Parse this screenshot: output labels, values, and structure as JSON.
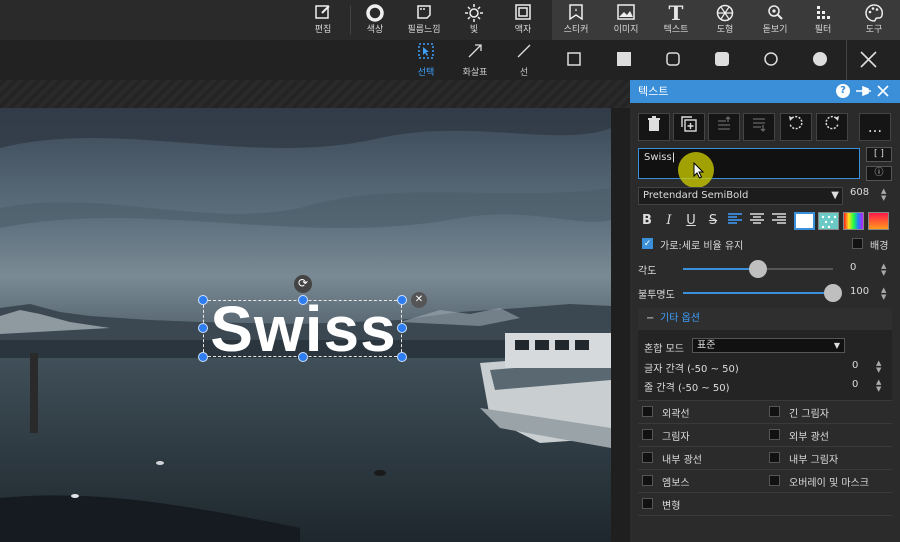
{
  "toolbar": {
    "tools": [
      {
        "label": "편집",
        "icon": "edit-icon"
      },
      {
        "label": "색상",
        "icon": "color-ring-icon"
      },
      {
        "label": "필름느낌",
        "icon": "film-icon"
      },
      {
        "label": "빛",
        "icon": "sun-icon"
      },
      {
        "label": "액자",
        "icon": "frame-icon"
      },
      {
        "label": "스티커",
        "icon": "sticker-icon"
      },
      {
        "label": "이미지",
        "icon": "image-icon"
      },
      {
        "label": "텍스트",
        "icon": "text-icon"
      },
      {
        "label": "도형",
        "icon": "shape-icon"
      },
      {
        "label": "돋보기",
        "icon": "magnifier-icon"
      },
      {
        "label": "필터",
        "icon": "filter-icon"
      },
      {
        "label": "도구",
        "icon": "palette-icon"
      }
    ]
  },
  "subbar": {
    "tools": [
      {
        "label": "선택",
        "icon": "select-icon"
      },
      {
        "label": "화살표",
        "icon": "arrow-icon"
      },
      {
        "label": "선",
        "icon": "line-icon"
      }
    ]
  },
  "canvas": {
    "text": "Swiss"
  },
  "panel": {
    "title": "텍스트",
    "text_value": "Swiss",
    "bracket_label": "[ ]",
    "info_label": "ⓘ",
    "more_label": "...",
    "font_name": "Pretendard SemiBold",
    "font_size": "608",
    "keep_ratio_label": "가로:세로 비율 유지",
    "background_label": "배경",
    "angle_label": "각도",
    "angle_value": "0",
    "angle_fraction": 0.5,
    "opacity_label": "불투명도",
    "opacity_value": "100",
    "opacity_fraction": 1.0,
    "advanced_label": "기타 옵션",
    "blend_label": "혼합 모드",
    "blend_value": "표준",
    "letter_spacing_label": "글자 간격 (-50 ~ 50)",
    "letter_spacing_value": "0",
    "line_spacing_label": "줄 간격 (-50 ~ 50)",
    "line_spacing_value": "0",
    "effects": [
      {
        "label": "외곽선"
      },
      {
        "label": "긴 그림자"
      },
      {
        "label": "그림자"
      },
      {
        "label": "외부 광선"
      },
      {
        "label": "내부 광선"
      },
      {
        "label": "내부 그림자"
      },
      {
        "label": "엠보스"
      },
      {
        "label": "오버레이 및 마스크"
      },
      {
        "label": "변형"
      }
    ]
  },
  "colors": {
    "accent": "#3a8fd8",
    "active_tool": "#3ea0ff"
  }
}
